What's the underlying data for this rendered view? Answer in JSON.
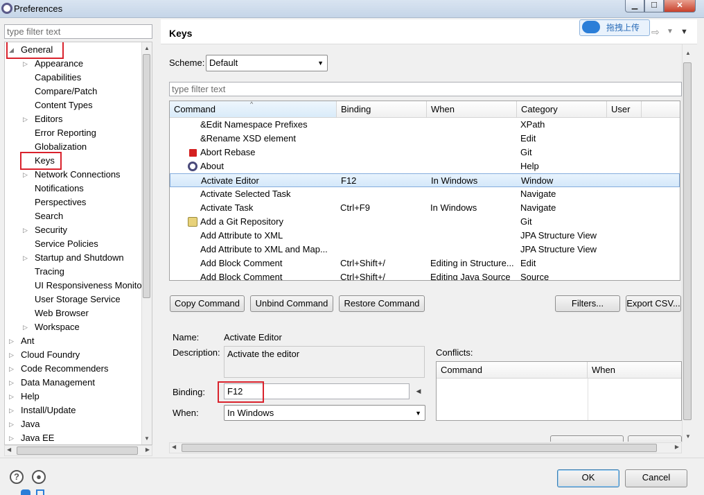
{
  "window": {
    "title": "Preferences"
  },
  "left": {
    "filter_placeholder": "type filter text",
    "tree": [
      {
        "label": "General",
        "level": 0,
        "expanded": true,
        "expandable": true,
        "highlighted": true
      },
      {
        "label": "Appearance",
        "level": 1,
        "expandable": true
      },
      {
        "label": "Capabilities",
        "level": 1
      },
      {
        "label": "Compare/Patch",
        "level": 1
      },
      {
        "label": "Content Types",
        "level": 1
      },
      {
        "label": "Editors",
        "level": 1,
        "expandable": true
      },
      {
        "label": "Error Reporting",
        "level": 1
      },
      {
        "label": "Globalization",
        "level": 1
      },
      {
        "label": "Keys",
        "level": 1,
        "highlighted": true
      },
      {
        "label": "Network Connections",
        "level": 1,
        "expandable": true
      },
      {
        "label": "Notifications",
        "level": 1
      },
      {
        "label": "Perspectives",
        "level": 1
      },
      {
        "label": "Search",
        "level": 1
      },
      {
        "label": "Security",
        "level": 1,
        "expandable": true
      },
      {
        "label": "Service Policies",
        "level": 1
      },
      {
        "label": "Startup and Shutdown",
        "level": 1,
        "expandable": true
      },
      {
        "label": "Tracing",
        "level": 1
      },
      {
        "label": "UI Responsiveness Monito",
        "level": 1
      },
      {
        "label": "User Storage Service",
        "level": 1
      },
      {
        "label": "Web Browser",
        "level": 1
      },
      {
        "label": "Workspace",
        "level": 1,
        "expandable": true
      },
      {
        "label": "Ant",
        "level": 0,
        "expandable": true
      },
      {
        "label": "Cloud Foundry",
        "level": 0,
        "expandable": true
      },
      {
        "label": "Code Recommenders",
        "level": 0,
        "expandable": true
      },
      {
        "label": "Data Management",
        "level": 0,
        "expandable": true
      },
      {
        "label": "Help",
        "level": 0,
        "expandable": true
      },
      {
        "label": "Install/Update",
        "level": 0,
        "expandable": true
      },
      {
        "label": "Java",
        "level": 0,
        "expandable": true
      },
      {
        "label": "Java EE",
        "level": 0,
        "expandable": true
      }
    ]
  },
  "header": {
    "title": "Keys",
    "upload_badge": "拖拽上传"
  },
  "scheme": {
    "label": "Scheme:",
    "value": "Default"
  },
  "keys_filter_placeholder": "type filter text",
  "table": {
    "columns": [
      "Command",
      "Binding",
      "When",
      "Category",
      "User"
    ],
    "rows": [
      {
        "command": "&Edit Namespace Prefixes",
        "binding": "",
        "when": "",
        "category": "XPath",
        "icon": ""
      },
      {
        "command": "&Rename XSD element",
        "binding": "",
        "when": "",
        "category": "Edit",
        "icon": ""
      },
      {
        "command": "Abort Rebase",
        "binding": "",
        "when": "",
        "category": "Git",
        "icon": "stop-icon"
      },
      {
        "command": "About",
        "binding": "",
        "when": "",
        "category": "Help",
        "icon": "eclipse-icon"
      },
      {
        "command": "Activate Editor",
        "binding": "F12",
        "when": "In Windows",
        "category": "Window",
        "icon": "",
        "selected": true
      },
      {
        "command": "Activate Selected Task",
        "binding": "",
        "when": "",
        "category": "Navigate",
        "icon": ""
      },
      {
        "command": "Activate Task",
        "binding": "Ctrl+F9",
        "when": "In Windows",
        "category": "Navigate",
        "icon": ""
      },
      {
        "command": "Add a Git Repository",
        "binding": "",
        "when": "",
        "category": "Git",
        "icon": "git-repo-icon"
      },
      {
        "command": "Add Attribute to XML",
        "binding": "",
        "when": "",
        "category": "JPA Structure View",
        "icon": ""
      },
      {
        "command": "Add Attribute to XML and Map...",
        "binding": "",
        "when": "",
        "category": "JPA Structure View",
        "icon": ""
      },
      {
        "command": "Add Block Comment",
        "binding": "Ctrl+Shift+/",
        "when": "Editing in Structure...",
        "category": "Edit",
        "icon": ""
      },
      {
        "command": "Add Block Comment",
        "binding": "Ctrl+Shift+/",
        "when": "Editing Java Source",
        "category": "Source",
        "icon": ""
      }
    ]
  },
  "buttons": {
    "copy": "Copy Command",
    "unbind": "Unbind Command",
    "restore": "Restore Command",
    "filters": "Filters...",
    "export": "Export CSV..."
  },
  "details": {
    "name_label": "Name:",
    "name_value": "Activate Editor",
    "description_label": "Description:",
    "description_value": "Activate the editor",
    "binding_label": "Binding:",
    "binding_value": "F12",
    "when_label": "When:",
    "when_value": "In Windows",
    "conflicts_label": "Conflicts:",
    "conflicts_columns": [
      "Command",
      "When"
    ]
  },
  "footer": {
    "ok": "OK",
    "cancel": "Cancel"
  },
  "colors": {
    "highlight_red": "#d9222c",
    "selection_blue": "#d4e8fa"
  }
}
